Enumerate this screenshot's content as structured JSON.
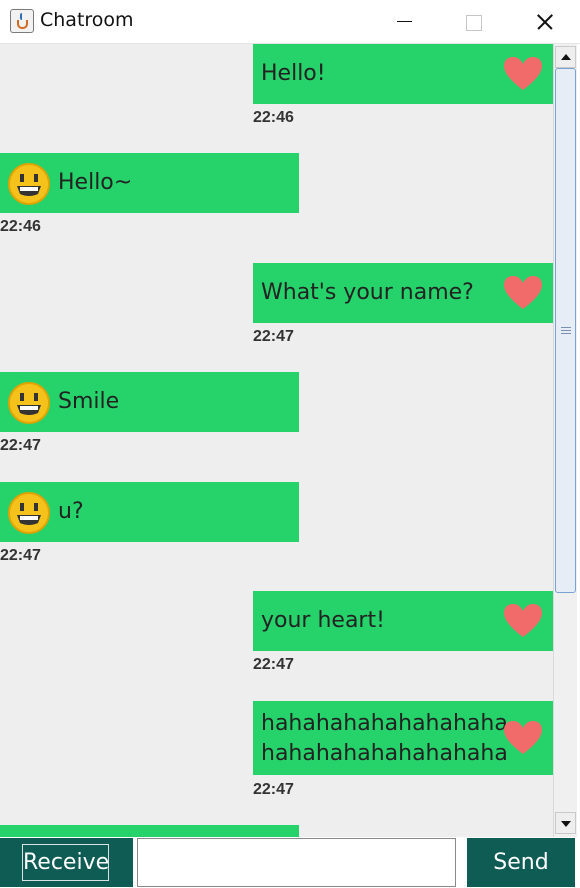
{
  "window": {
    "title": "Chatroom",
    "app_icon": "java-cup-icon",
    "controls": [
      "minimize-icon",
      "maximize-icon",
      "close-icon"
    ]
  },
  "messages": [
    {
      "side": "right",
      "lines": [
        "Hello!"
      ],
      "time": "22:46",
      "icon": "heart-icon"
    },
    {
      "side": "left",
      "lines": [
        "Hello~"
      ],
      "time": "22:46",
      "icon": "smiley-icon"
    },
    {
      "side": "right",
      "lines": [
        "What's your name?"
      ],
      "time": "22:47",
      "icon": "heart-icon"
    },
    {
      "side": "left",
      "lines": [
        "Smile"
      ],
      "time": "22:47",
      "icon": "smiley-icon"
    },
    {
      "side": "left",
      "lines": [
        "u?"
      ],
      "time": "22:47",
      "icon": "smiley-icon"
    },
    {
      "side": "right",
      "lines": [
        "your heart!"
      ],
      "time": "22:47",
      "icon": "heart-icon"
    },
    {
      "side": "right",
      "lines": [
        "hahahahahahahahaha",
        "hahahahahahahahaha"
      ],
      "time": "22:47",
      "icon": "heart-icon"
    }
  ],
  "footer": {
    "receive_label": "Receive",
    "input_value": "",
    "send_label": "Send"
  },
  "colors": {
    "bubble": "#26d26a",
    "button": "#0f5c54",
    "chat_background": "#eeeeee",
    "heart": "#f26b6b",
    "smiley": "#f5c21b"
  }
}
